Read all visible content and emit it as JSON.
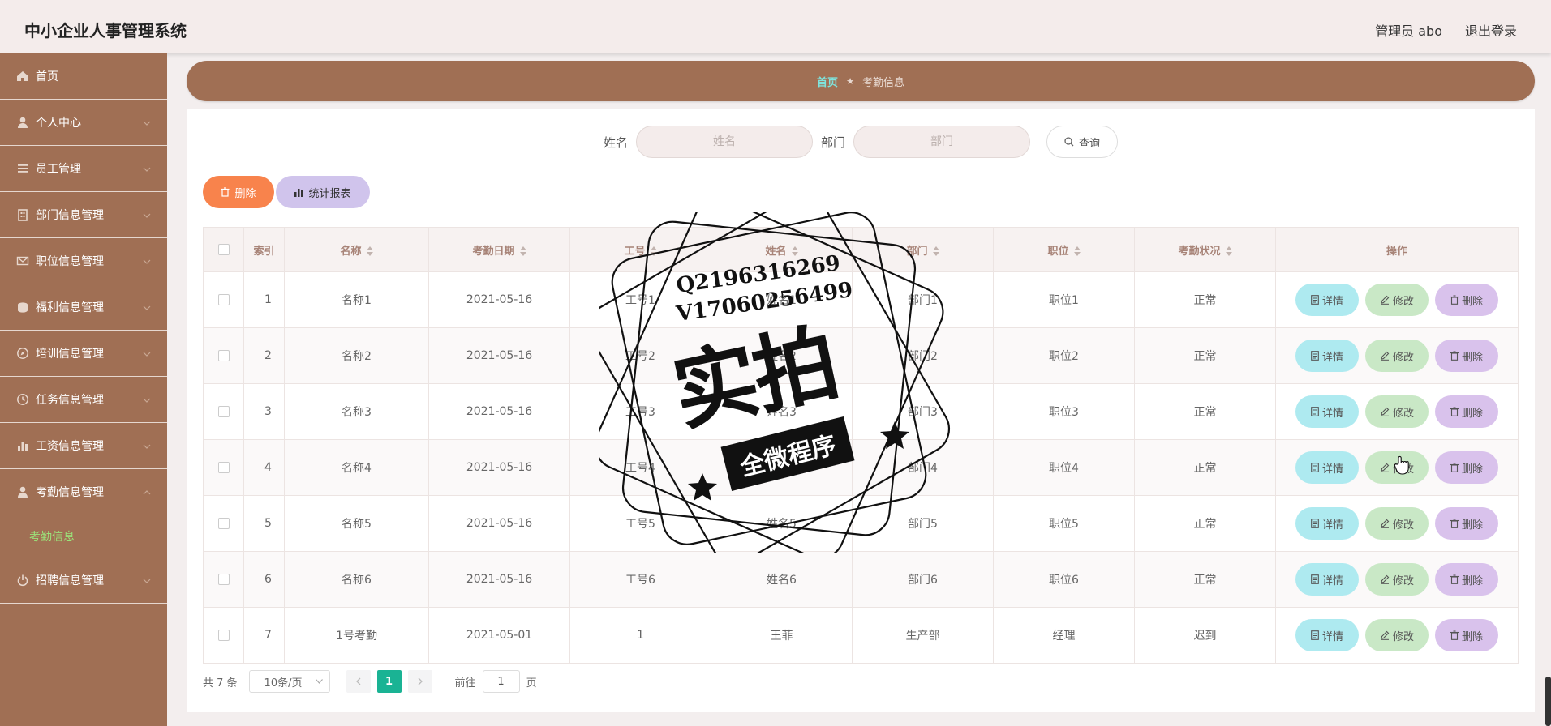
{
  "app": {
    "title": "中小企业人事管理系统",
    "user": "管理员 abo",
    "logout": "退出登录"
  },
  "sidebar": {
    "items": [
      {
        "label": "首页",
        "icon": "home-icon"
      },
      {
        "label": "个人中心",
        "icon": "user-icon"
      },
      {
        "label": "员工管理",
        "icon": "list-icon"
      },
      {
        "label": "部门信息管理",
        "icon": "building-icon"
      },
      {
        "label": "职位信息管理",
        "icon": "mail-icon"
      },
      {
        "label": "福利信息管理",
        "icon": "gift-icon"
      },
      {
        "label": "培训信息管理",
        "icon": "compass-icon"
      },
      {
        "label": "任务信息管理",
        "icon": "clock-icon"
      },
      {
        "label": "工资信息管理",
        "icon": "bar-chart-icon"
      },
      {
        "label": "考勤信息管理",
        "icon": "user-icon"
      },
      {
        "label": "招聘信息管理",
        "icon": "power-icon"
      }
    ],
    "active_sub": "考勤信息"
  },
  "breadcrumb": {
    "home": "首页",
    "current": "考勤信息"
  },
  "search": {
    "name_label": "姓名",
    "name_placeholder": "姓名",
    "dept_label": "部门",
    "dept_placeholder": "部门",
    "button": "查询"
  },
  "actions": {
    "delete": "删除",
    "report": "统计报表"
  },
  "table": {
    "headers": {
      "index": "索引",
      "name": "名称",
      "date": "考勤日期",
      "worker_no": "工号",
      "staff_name": "姓名",
      "dept": "部门",
      "position": "职位",
      "status": "考勤状况",
      "ops": "操作"
    },
    "rows": [
      {
        "index": "1",
        "name": "名称1",
        "date": "2021-05-16",
        "worker_no": "工号1",
        "staff_name": "姓名1",
        "dept": "部门1",
        "position": "职位1",
        "status": "正常"
      },
      {
        "index": "2",
        "name": "名称2",
        "date": "2021-05-16",
        "worker_no": "工号2",
        "staff_name": "姓名2",
        "dept": "部门2",
        "position": "职位2",
        "status": "正常"
      },
      {
        "index": "3",
        "name": "名称3",
        "date": "2021-05-16",
        "worker_no": "工号3",
        "staff_name": "姓名3",
        "dept": "部门3",
        "position": "职位3",
        "status": "正常"
      },
      {
        "index": "4",
        "name": "名称4",
        "date": "2021-05-16",
        "worker_no": "工号4",
        "staff_name": "姓名4",
        "dept": "部门4",
        "position": "职位4",
        "status": "正常"
      },
      {
        "index": "5",
        "name": "名称5",
        "date": "2021-05-16",
        "worker_no": "工号5",
        "staff_name": "姓名5",
        "dept": "部门5",
        "position": "职位5",
        "status": "正常"
      },
      {
        "index": "6",
        "name": "名称6",
        "date": "2021-05-16",
        "worker_no": "工号6",
        "staff_name": "姓名6",
        "dept": "部门6",
        "position": "职位6",
        "status": "正常"
      },
      {
        "index": "7",
        "name": "1号考勤",
        "date": "2021-05-01",
        "worker_no": "1",
        "staff_name": "王菲",
        "dept": "生产部",
        "position": "经理",
        "status": "迟到"
      }
    ],
    "row_ops": {
      "detail": "详情",
      "edit": "修改",
      "delete": "删除"
    }
  },
  "pagination": {
    "total": "共 7 条",
    "page_size": "10条/页",
    "current_page": "1",
    "goto_label": "前往",
    "goto_value": "1",
    "page_suffix": "页"
  },
  "watermark": {
    "line1": "Q2196316269",
    "line2": "V17060256499",
    "big": "实拍",
    "ribbon": "全微程序"
  },
  "colors": {
    "sidebar": "#a06f54",
    "topbar": "#f4eceb",
    "active_sub": "#9be37a",
    "delete_btn": "#f8834c",
    "report_btn": "#d0c4ec",
    "page_active": "#1ab394"
  }
}
